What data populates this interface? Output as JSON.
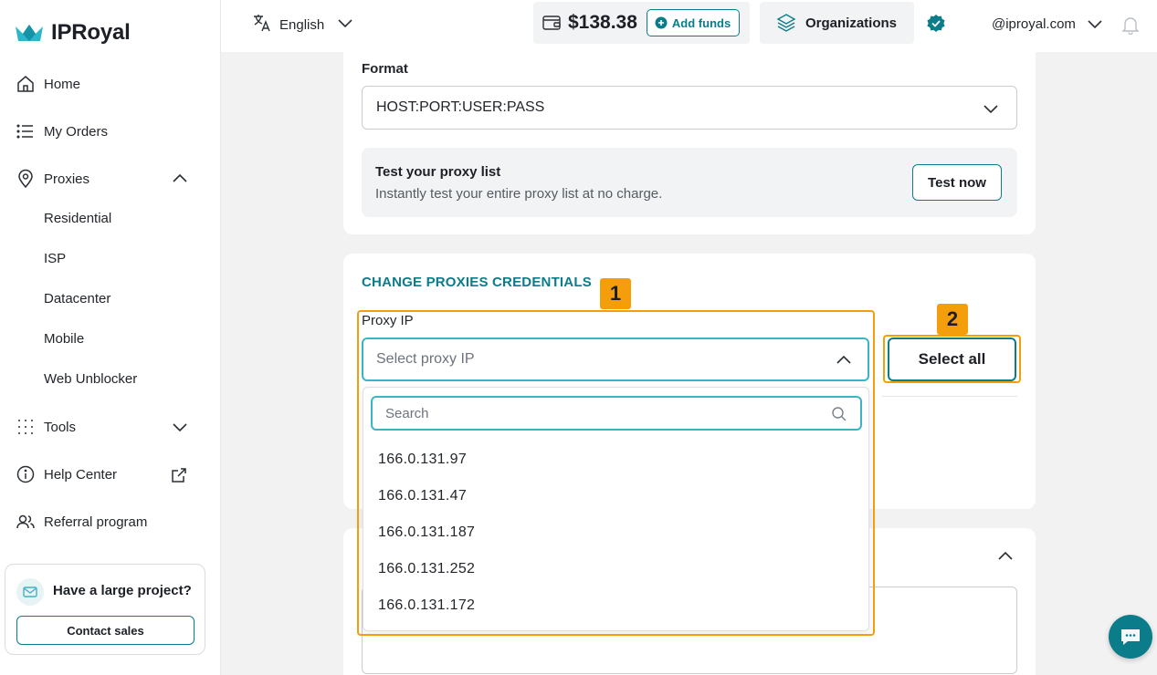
{
  "brand": {
    "name": "IPRoyal",
    "accent": "#0b7c8a",
    "annotation_color": "#f59e0b"
  },
  "sidebar": {
    "items": [
      {
        "label": "Home",
        "icon": "home-icon"
      },
      {
        "label": "My Orders",
        "icon": "list-icon"
      },
      {
        "label": "Proxies",
        "icon": "location-pin-icon"
      },
      {
        "label": "Tools",
        "icon": "grid-dots-icon"
      },
      {
        "label": "Help Center",
        "icon": "info-icon"
      },
      {
        "label": "Referral program",
        "icon": "users-icon"
      }
    ],
    "proxy_subitems": [
      "Residential",
      "ISP",
      "Datacenter",
      "Mobile",
      "Web Unblocker"
    ],
    "promo": {
      "title": "Have a large project?",
      "button": "Contact sales"
    }
  },
  "topbar": {
    "language": "English",
    "balance": "$138.38",
    "add_funds": "Add funds",
    "organizations": "Organizations",
    "email": "@iproyal.com"
  },
  "format": {
    "label": "Format",
    "value": "HOST:PORT:USER:PASS"
  },
  "test_panel": {
    "title": "Test your proxy list",
    "subtitle": "Instantly test your entire proxy list at no charge.",
    "button": "Test now"
  },
  "credentials": {
    "section_title": "CHANGE PROXIES CREDENTIALS",
    "proxy_ip_label": "Proxy IP",
    "proxy_ip_placeholder": "Select proxy IP",
    "search_placeholder": "Search",
    "options": [
      "166.0.131.97",
      "166.0.131.47",
      "166.0.131.187",
      "166.0.131.252",
      "166.0.131.172"
    ],
    "select_all": "Select all"
  },
  "annotations": {
    "badge1": "1",
    "badge2": "2"
  }
}
